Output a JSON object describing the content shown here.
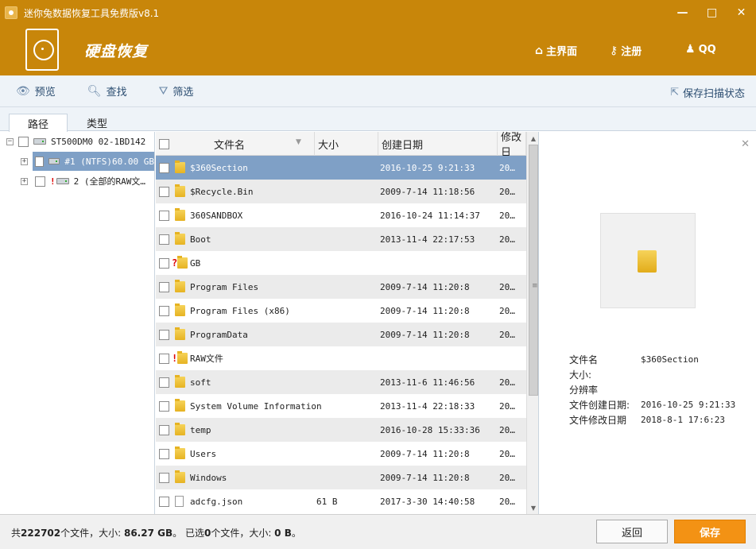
{
  "window": {
    "title": "迷你兔数据恢复工具免费版v8.1",
    "minimize": "—",
    "maximize": "□",
    "close": "✕"
  },
  "header": {
    "brand": "硬盘恢复",
    "nav": [
      {
        "icon": "home-icon",
        "glyph": "⌂",
        "label": "主界面"
      },
      {
        "icon": "key-icon",
        "glyph": "⚷",
        "label": "注册"
      },
      {
        "icon": "qq-icon",
        "glyph": "♟",
        "label": "QQ"
      }
    ]
  },
  "toolbar": {
    "preview": "预览",
    "find": "查找",
    "filter": "筛选",
    "save_scan": "保存扫描状态"
  },
  "tabs": {
    "path": "路径",
    "type": "类型"
  },
  "tree": {
    "root": "ST500DM0 02-1BD142",
    "partition1": "#1 (NTFS)60.00 GB",
    "partition2": "2 (全部的RAW文…"
  },
  "filelist": {
    "columns": {
      "name": "文件名",
      "size": "大小",
      "created": "创建日期",
      "modified": "修改日"
    },
    "rows": [
      {
        "name": "$360Section",
        "size": "",
        "created": "2016-10-25 9:21:33",
        "modified": "20…",
        "icon": "folder"
      },
      {
        "name": "$Recycle.Bin",
        "size": "",
        "created": "2009-7-14 11:18:56",
        "modified": "20…",
        "icon": "folder"
      },
      {
        "name": "360SANDBOX",
        "size": "",
        "created": "2016-10-24 11:14:37",
        "modified": "20…",
        "icon": "folder"
      },
      {
        "name": "Boot",
        "size": "",
        "created": "2013-11-4 22:17:53",
        "modified": "20…",
        "icon": "folder"
      },
      {
        "name": "GB",
        "size": "",
        "created": "",
        "modified": "",
        "icon": "unknown-folder"
      },
      {
        "name": "Program Files",
        "size": "",
        "created": "2009-7-14 11:20:8",
        "modified": "20…",
        "icon": "folder"
      },
      {
        "name": "Program Files (x86)",
        "size": "",
        "created": "2009-7-14 11:20:8",
        "modified": "20…",
        "icon": "folder"
      },
      {
        "name": "ProgramData",
        "size": "",
        "created": "2009-7-14 11:20:8",
        "modified": "20…",
        "icon": "folder"
      },
      {
        "name": "RAW文件",
        "size": "",
        "created": "",
        "modified": "",
        "icon": "raw-folder"
      },
      {
        "name": "soft",
        "size": "",
        "created": "2013-11-6 11:46:56",
        "modified": "20…",
        "icon": "folder"
      },
      {
        "name": "System Volume Information",
        "size": "",
        "created": "2013-11-4 22:18:33",
        "modified": "20…",
        "icon": "folder"
      },
      {
        "name": "temp",
        "size": "",
        "created": "2016-10-28 15:33:36",
        "modified": "20…",
        "icon": "folder"
      },
      {
        "name": "Users",
        "size": "",
        "created": "2009-7-14 11:20:8",
        "modified": "20…",
        "icon": "folder"
      },
      {
        "name": "Windows",
        "size": "",
        "created": "2009-7-14 11:20:8",
        "modified": "20…",
        "icon": "folder"
      },
      {
        "name": "adcfg.json",
        "size": "61 B",
        "created": "2017-3-30 14:40:58",
        "modified": "20…",
        "icon": "file"
      }
    ]
  },
  "preview": {
    "labels": {
      "name": "文件名",
      "size": "大小:",
      "resolution": "分辨率",
      "created": "文件创建日期:",
      "modified": "文件修改日期"
    },
    "values": {
      "name": "$360Section",
      "size": "",
      "resolution": "",
      "created": "2016-10-25 9:21:33",
      "modified": "2018-8-1 17:6:23"
    }
  },
  "status": {
    "p1": "共",
    "total_files": "222702",
    "p2": "个文件，大小: ",
    "total_size": "86.27 GB",
    "p3": "。 已选",
    "selected_files": "0",
    "p4": "个文件，大小: ",
    "selected_size": "0 B",
    "p5": "。"
  },
  "buttons": {
    "back": "返回",
    "save": "保存"
  }
}
